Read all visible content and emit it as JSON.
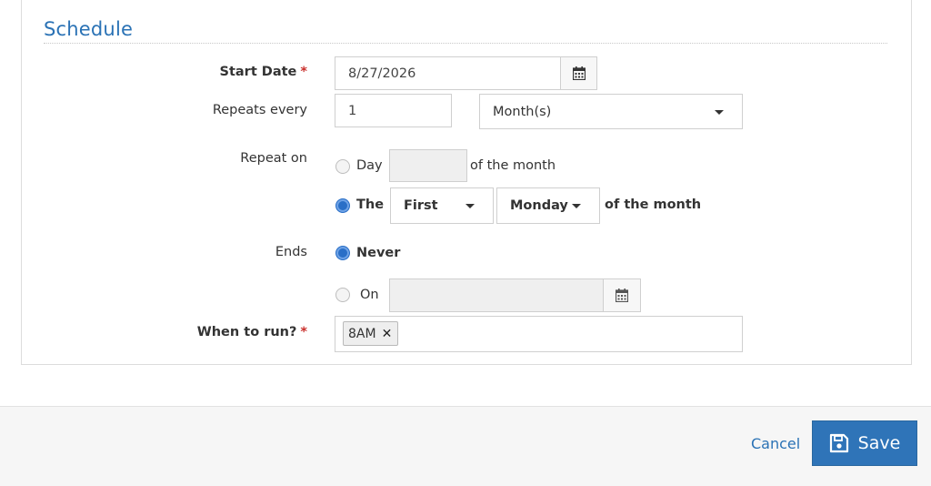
{
  "section": {
    "title": "Schedule"
  },
  "start_date": {
    "label": "Start Date",
    "required": "*",
    "value": "8/27/2026",
    "icon": "calendar-icon"
  },
  "repeats": {
    "label": "Repeats every",
    "value": "1",
    "unit": "Month(s)"
  },
  "repeat_on": {
    "label": "Repeat on",
    "day_option": {
      "label": "Day",
      "suffix": "of the month",
      "selected": false
    },
    "the_option": {
      "label": "The",
      "ordinal": "First",
      "weekday": "Monday",
      "suffix": "of the month",
      "selected": true
    }
  },
  "ends": {
    "label": "Ends",
    "never_option": {
      "label": "Never",
      "selected": true
    },
    "on_option": {
      "label": "On",
      "selected": false,
      "value": ""
    }
  },
  "when_to_run": {
    "label": "When to run?",
    "required": "*",
    "tags": [
      {
        "label": "8AM",
        "remove": "✕"
      }
    ]
  },
  "footer": {
    "cancel_label": "Cancel",
    "save_label": "Save"
  },
  "colors": {
    "accent": "#2a72b5",
    "required": "#c9302c",
    "radio_selected": "#2a6fc7"
  }
}
